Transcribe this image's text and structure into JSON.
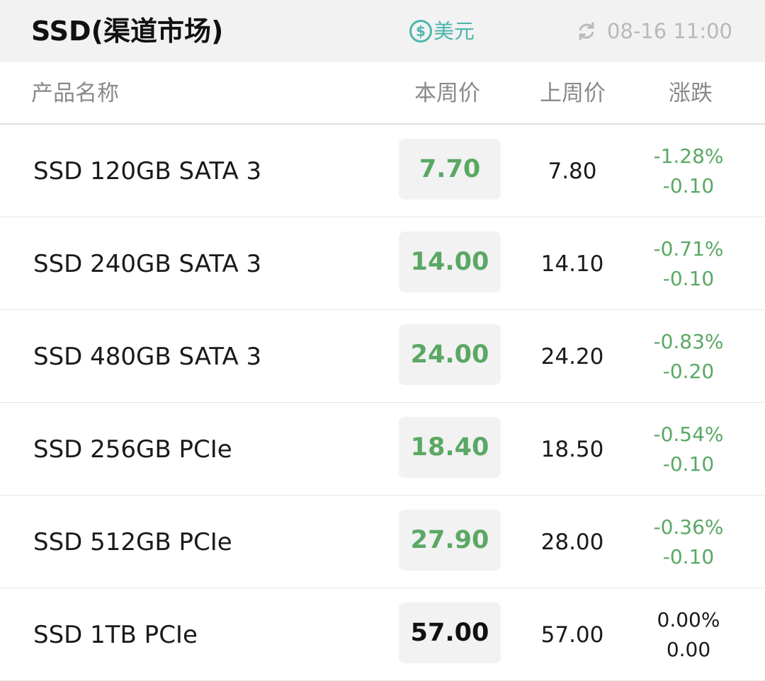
{
  "header": {
    "title": "SSD(渠道市场)",
    "currency_label": "美元",
    "currency_icon": "dollar-circle-icon",
    "updated_time": "08-16 11:00",
    "refresh_icon": "refresh-icon",
    "accent_color": "#4db6ac"
  },
  "columns": {
    "name": "产品名称",
    "this_week": "本周价",
    "last_week": "上周价",
    "change": "涨跌"
  },
  "colors": {
    "down": "#5aa864",
    "flat": "#111111"
  },
  "rows": [
    {
      "name": "SSD 120GB SATA 3",
      "this_week": "7.70",
      "last_week": "7.80",
      "change_pct": "-1.28%",
      "change_abs": "-0.10",
      "trend": "down"
    },
    {
      "name": "SSD 240GB SATA 3",
      "this_week": "14.00",
      "last_week": "14.10",
      "change_pct": "-0.71%",
      "change_abs": "-0.10",
      "trend": "down"
    },
    {
      "name": "SSD 480GB SATA 3",
      "this_week": "24.00",
      "last_week": "24.20",
      "change_pct": "-0.83%",
      "change_abs": "-0.20",
      "trend": "down"
    },
    {
      "name": "SSD 256GB PCIe",
      "this_week": "18.40",
      "last_week": "18.50",
      "change_pct": "-0.54%",
      "change_abs": "-0.10",
      "trend": "down"
    },
    {
      "name": "SSD 512GB PCIe",
      "this_week": "27.90",
      "last_week": "28.00",
      "change_pct": "-0.36%",
      "change_abs": "-0.10",
      "trend": "down"
    },
    {
      "name": "SSD 1TB PCIe",
      "this_week": "57.00",
      "last_week": "57.00",
      "change_pct": "0.00%",
      "change_abs": "0.00",
      "trend": "flat"
    }
  ]
}
